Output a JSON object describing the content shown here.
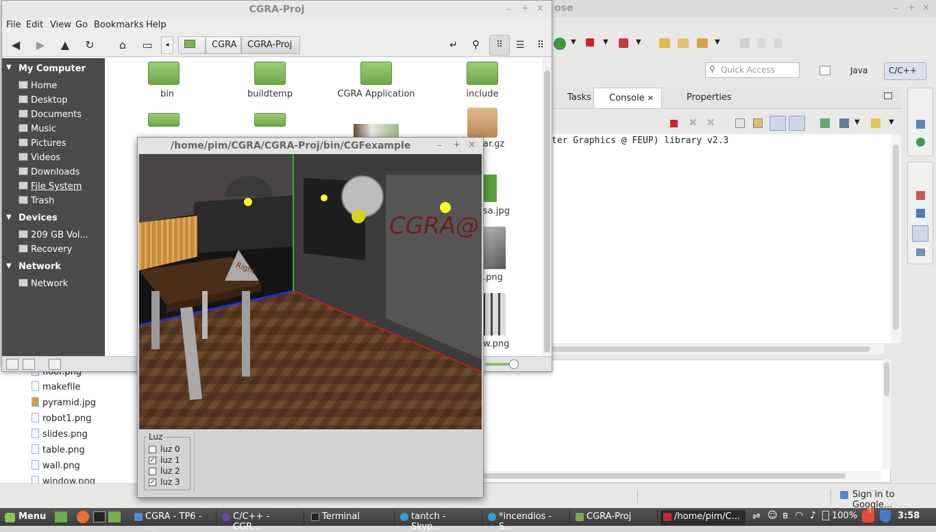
{
  "eclipse": {
    "title_fragment": "ose",
    "quick_access_placeholder": "Quick Access",
    "perspectives": [
      "Java",
      "C/C++"
    ],
    "view_tabs": [
      "Tasks",
      "Console",
      "Properties"
    ],
    "console_text": "ter Graphics @ FEUP) library v2.3",
    "status_right": "Sign in to Google...",
    "tree_files": [
      "floor.png",
      "makefile",
      "pyramid.jpg",
      "robot1.png",
      "slides.png",
      "table.png",
      "wall.png",
      "window.png"
    ]
  },
  "nemo": {
    "title": "CGRA-Proj",
    "menu": [
      "File",
      "Edit",
      "View",
      "Go",
      "Bookmarks",
      "Help"
    ],
    "breadcrumbs": [
      "CGRA",
      "CGRA-Proj"
    ],
    "sidebar": {
      "my_computer": "My Computer",
      "computer_items": [
        "Home",
        "Desktop",
        "Documents",
        "Music",
        "Pictures",
        "Videos",
        "Downloads",
        "File System",
        "Trash"
      ],
      "devices": "Devices",
      "device_items": [
        "209 GB Vol...",
        "Recovery"
      ],
      "network": "Network",
      "network_items": [
        "Network"
      ]
    },
    "files": [
      "bin",
      "buildtemp",
      "CGRA Application",
      "include"
    ],
    "partial_files": [
      "ar.gz",
      "sa.jpg",
      ".png",
      "w.png"
    ]
  },
  "cgf": {
    "title": "/home/pim/CGRA/CGRA-Proj/bin/CGFexample",
    "group_label": "Luz",
    "lights": [
      {
        "label": "luz 0",
        "checked": false
      },
      {
        "label": "luz 1",
        "checked": true
      },
      {
        "label": "luz 2",
        "checked": false
      },
      {
        "label": "luz 3",
        "checked": true
      }
    ],
    "scene_text": "CGRA@",
    "pyramid_text": "Right"
  },
  "taskbar": {
    "menu_label": "Menu",
    "tasks": [
      "CGRA - TP6 - ...",
      "C/C++ - CGR...",
      "Terminal",
      "tantch - Skyp...",
      "*incendios - S...",
      "CGRA-Proj",
      "/home/pim/C..."
    ],
    "battery": "100%",
    "notification_count": "1",
    "clock": "3:58"
  }
}
